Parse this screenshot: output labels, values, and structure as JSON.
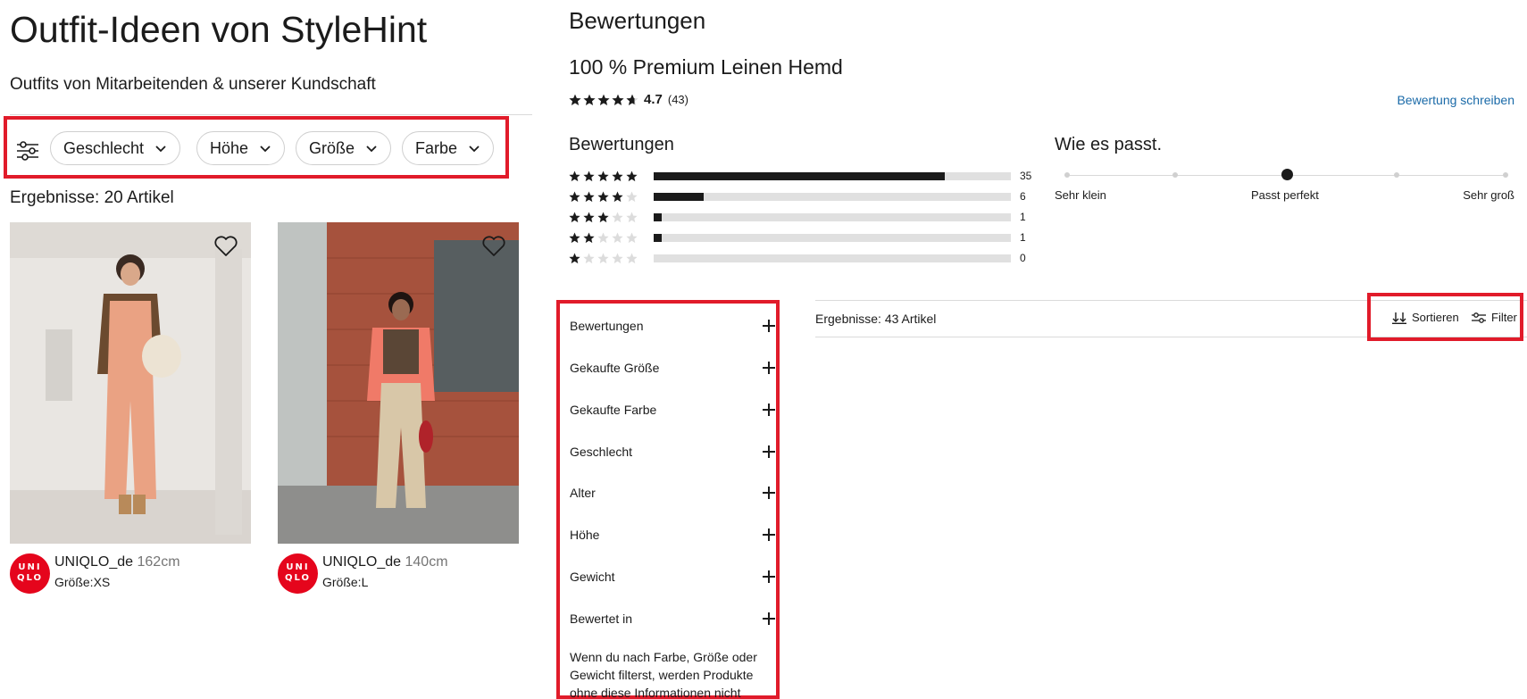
{
  "stylehint": {
    "title": "Outfit-Ideen von StyleHint",
    "subtitle": "Outfits von Mitarbeitenden & unserer Kundschaft",
    "filters": [
      "Geschlecht",
      "Höhe",
      "Größe",
      "Farbe"
    ],
    "results": "Ergebnisse: 20 Artikel",
    "cards": [
      {
        "user": "UNIQLO_de",
        "height": "162cm",
        "size": "Größe:XS"
      },
      {
        "user": "UNIQLO_de",
        "height": "140cm",
        "size": "Größe:L"
      }
    ],
    "logo_text": [
      "UNI",
      "QLO"
    ]
  },
  "reviews": {
    "title": "Bewertungen",
    "product_name": "100 % Premium Leinen Hemd",
    "rating_value": "4.7",
    "rating_count": "(43)",
    "rating_stars": 4.7,
    "write_review": "Bewertung schreiben",
    "histogram_title": "Bewertungen",
    "histogram": [
      {
        "stars": 5,
        "count": "35",
        "value": 35
      },
      {
        "stars": 4,
        "count": "6",
        "value": 6
      },
      {
        "stars": 3,
        "count": "1",
        "value": 1
      },
      {
        "stars": 2,
        "count": "1",
        "value": 1
      },
      {
        "stars": 1,
        "count": "0",
        "value": 0
      }
    ],
    "histogram_total": 43,
    "fit": {
      "title": "Wie es passt.",
      "labels": [
        "Sehr klein",
        "Passt perfekt",
        "Sehr groß"
      ],
      "selected_index": 2
    },
    "facets": [
      "Bewertungen",
      "Gekaufte Größe",
      "Gekaufte Farbe",
      "Geschlecht",
      "Alter",
      "Höhe",
      "Gewicht",
      "Bewertet in"
    ],
    "facet_note": "Wenn du nach Farbe, Größe oder Gewicht filterst, werden Produkte ohne diese Informationen nicht angezeigt.",
    "results": "Ergebnisse: 43 Artikel",
    "sort_label": "Sortieren",
    "filter_label": "Filter"
  },
  "colors": {
    "highlight": "#e11b2a",
    "brand_red": "#e5051c",
    "link": "#1a6aa8",
    "bar_fill": "#1b1b1b",
    "bar_bg": "#e0e0e0"
  }
}
